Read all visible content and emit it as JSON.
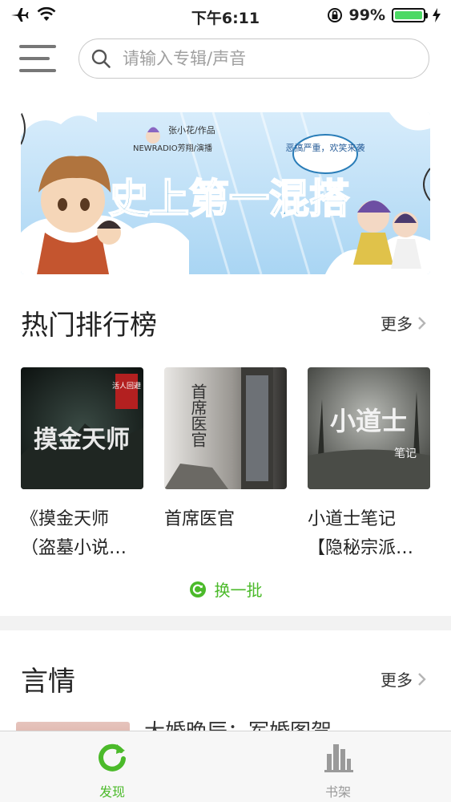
{
  "status_bar": {
    "time": "下午6:11",
    "battery_percent": "99%",
    "battery_level": 0.99,
    "icons": [
      "airplane-icon",
      "wifi-icon",
      "orientation-lock-icon",
      "charging-icon"
    ]
  },
  "search": {
    "placeholder": "请输入专辑/声音"
  },
  "banner": {
    "title": "史上第一混搭",
    "tag": "恶搞严重，欢笑来袭",
    "credit_line1": "张小花/作品",
    "credit_line2": "NEWRADIO芳翔/演播"
  },
  "hot_section": {
    "title": "热门排行榜",
    "more_label": "更多",
    "refresh_label": "换一批",
    "items": [
      {
        "title_line1": "《摸金天师",
        "title_line2": "（盗墓小说…",
        "cover_text": "摸金天师",
        "cover_badge": "活人回避"
      },
      {
        "title_line1": "首席医官",
        "title_line2": "",
        "cover_text": "首席医官"
      },
      {
        "title_line1": "小道士笔记",
        "title_line2": "【隐秘宗派…",
        "cover_text": "小道士",
        "cover_subtext": "笔记"
      }
    ]
  },
  "romance_section": {
    "title": "言情",
    "more_label": "更多",
    "first_item_partial": "大婚晚辰：军婚图贺"
  },
  "tab_bar": {
    "tabs": [
      {
        "label": "发现",
        "active": true,
        "color": "#4bba2a"
      },
      {
        "label": "书架",
        "active": false,
        "color": "#9a9a9a"
      }
    ]
  },
  "colors": {
    "accent": "#4bba2a"
  }
}
